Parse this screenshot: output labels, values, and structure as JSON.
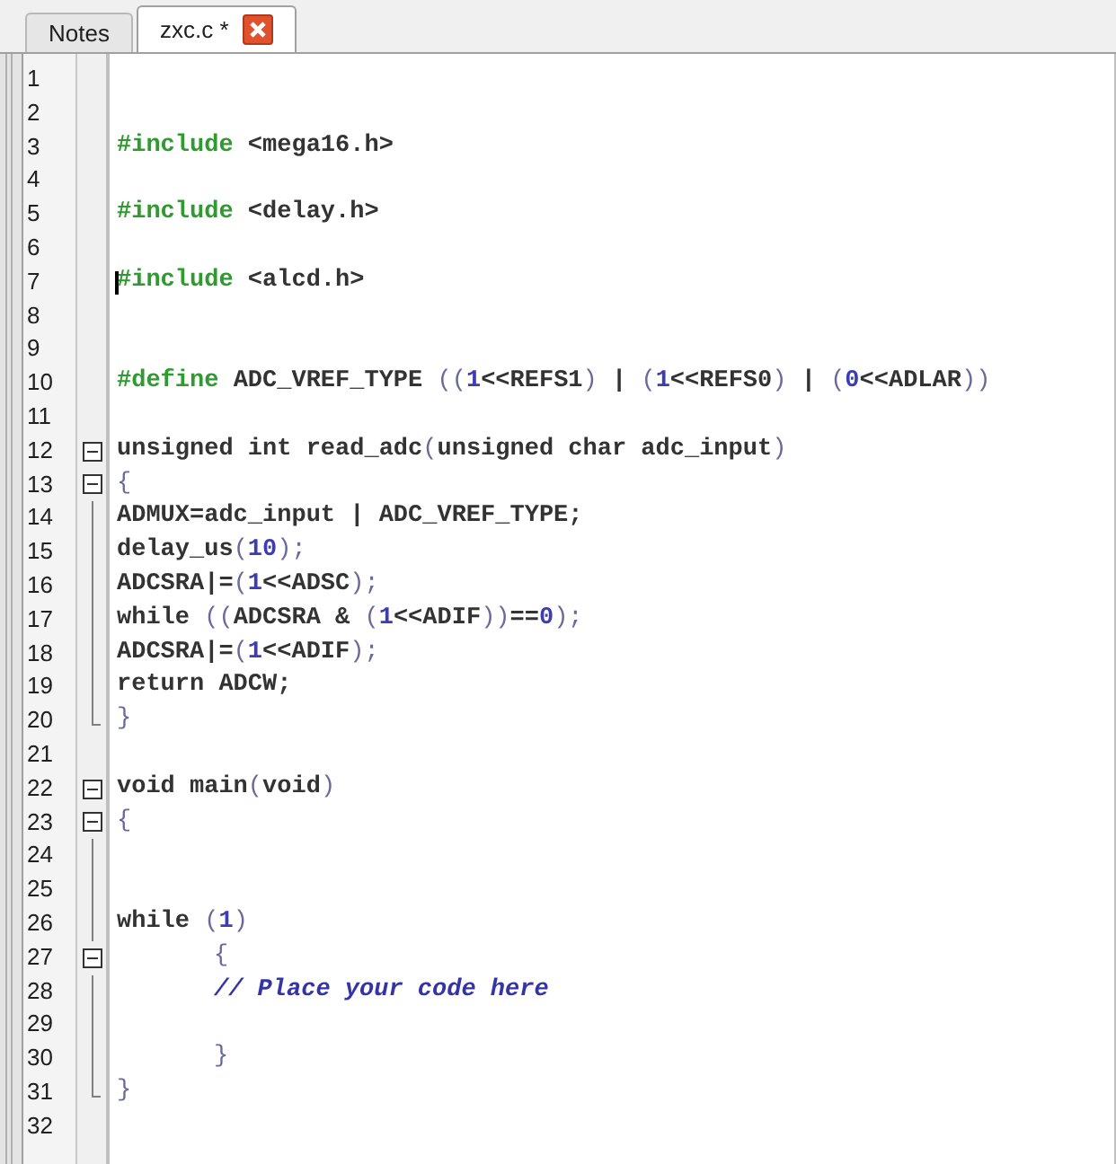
{
  "tabs": [
    {
      "label": "Notes",
      "selected": false,
      "closable": false
    },
    {
      "label": "zxc.c *",
      "selected": true,
      "closable": true
    }
  ],
  "lines": [
    {
      "number": "1",
      "kind": "plain",
      "caret": false
    },
    {
      "number": "2",
      "kind": "plain",
      "caret": false
    },
    {
      "number": "3",
      "kind": "plain",
      "indented": false,
      "caret": false,
      "tokens": [
        {
          "kind": "directive",
          "text": "#include"
        },
        {
          "kind": "plain",
          "text": " <mega16.h>"
        }
      ]
    },
    {
      "number": "4",
      "kind": "plain",
      "caret": false
    },
    {
      "number": "5",
      "kind": "plain",
      "indented": false,
      "caret": false,
      "tokens": [
        {
          "kind": "directive",
          "text": "#include"
        },
        {
          "kind": "plain",
          "text": " <delay.h>"
        }
      ]
    },
    {
      "number": "6",
      "kind": "plain",
      "caret": false
    },
    {
      "number": "7",
      "kind": "plain",
      "indented": false,
      "caret": true,
      "tokens": [
        {
          "kind": "directive",
          "text": "#include"
        },
        {
          "kind": "plain",
          "text": " <alcd.h>"
        }
      ]
    },
    {
      "number": "8",
      "kind": "plain",
      "caret": false
    },
    {
      "number": "9",
      "kind": "plain",
      "caret": false
    },
    {
      "number": "10",
      "kind": "plain",
      "indented": false,
      "caret": false,
      "tokens": [
        {
          "kind": "directive",
          "text": "#define"
        },
        {
          "kind": "plain",
          "text": " ADC_VREF_TYPE "
        },
        {
          "kind": "punct",
          "text": "(("
        },
        {
          "kind": "number",
          "text": "1"
        },
        {
          "kind": "plain",
          "text": "<<REFS1"
        },
        {
          "kind": "punct",
          "text": ")"
        },
        {
          "kind": "plain",
          "text": " | "
        },
        {
          "kind": "punct",
          "text": "("
        },
        {
          "kind": "number",
          "text": "1"
        },
        {
          "kind": "plain",
          "text": "<<REFS0"
        },
        {
          "kind": "punct",
          "text": ")"
        },
        {
          "kind": "plain",
          "text": " | "
        },
        {
          "kind": "punct",
          "text": "("
        },
        {
          "kind": "number",
          "text": "0"
        },
        {
          "kind": "plain",
          "text": "<<ADLAR"
        },
        {
          "kind": "punct",
          "text": "))"
        }
      ]
    },
    {
      "number": "11",
      "kind": "plain",
      "caret": false
    },
    {
      "number": "12",
      "kind": "fold-start",
      "indented": false,
      "caret": false,
      "tokens": [
        {
          "kind": "plain",
          "text": "unsigned int read_adc"
        },
        {
          "kind": "punct",
          "text": "("
        },
        {
          "kind": "plain",
          "text": "unsigned char adc_input"
        },
        {
          "kind": "punct",
          "text": ")"
        }
      ]
    },
    {
      "number": "13",
      "kind": "fold-start",
      "indented": false,
      "caret": false,
      "tokens": [
        {
          "kind": "punct",
          "text": "{"
        }
      ]
    },
    {
      "number": "14",
      "kind": "fold-inner",
      "indented": false,
      "caret": false,
      "tokens": [
        {
          "kind": "plain",
          "text": "ADMUX=adc_input | ADC_VREF_TYPE;"
        }
      ]
    },
    {
      "number": "15",
      "kind": "fold-inner",
      "indented": false,
      "caret": false,
      "tokens": [
        {
          "kind": "plain",
          "text": "delay_us"
        },
        {
          "kind": "punct",
          "text": "("
        },
        {
          "kind": "number",
          "text": "10"
        },
        {
          "kind": "punct",
          "text": ");"
        }
      ]
    },
    {
      "number": "16",
      "kind": "fold-inner",
      "indented": false,
      "caret": false,
      "tokens": [
        {
          "kind": "plain",
          "text": "ADCSRA|="
        },
        {
          "kind": "punct",
          "text": "("
        },
        {
          "kind": "number",
          "text": "1"
        },
        {
          "kind": "plain",
          "text": "<<ADSC"
        },
        {
          "kind": "punct",
          "text": ");"
        }
      ]
    },
    {
      "number": "17",
      "kind": "fold-inner",
      "indented": false,
      "caret": false,
      "tokens": [
        {
          "kind": "plain",
          "text": "while "
        },
        {
          "kind": "punct",
          "text": "(("
        },
        {
          "kind": "plain",
          "text": "ADCSRA & "
        },
        {
          "kind": "punct",
          "text": "("
        },
        {
          "kind": "number",
          "text": "1"
        },
        {
          "kind": "plain",
          "text": "<<ADIF"
        },
        {
          "kind": "punct",
          "text": "))"
        },
        {
          "kind": "plain",
          "text": "=="
        },
        {
          "kind": "number",
          "text": "0"
        },
        {
          "kind": "punct",
          "text": ");"
        }
      ]
    },
    {
      "number": "18",
      "kind": "fold-inner",
      "indented": false,
      "caret": false,
      "tokens": [
        {
          "kind": "plain",
          "text": "ADCSRA|="
        },
        {
          "kind": "punct",
          "text": "("
        },
        {
          "kind": "number",
          "text": "1"
        },
        {
          "kind": "plain",
          "text": "<<ADIF"
        },
        {
          "kind": "punct",
          "text": ");"
        }
      ]
    },
    {
      "number": "19",
      "kind": "fold-inner",
      "indented": false,
      "caret": false,
      "tokens": [
        {
          "kind": "plain",
          "text": "return ADCW;"
        }
      ]
    },
    {
      "number": "20",
      "kind": "fold-end",
      "indented": false,
      "caret": false,
      "tokens": [
        {
          "kind": "punct",
          "text": "}"
        }
      ]
    },
    {
      "number": "21",
      "kind": "plain",
      "caret": false
    },
    {
      "number": "22",
      "kind": "fold-start",
      "indented": false,
      "caret": false,
      "tokens": [
        {
          "kind": "plain",
          "text": "void main"
        },
        {
          "kind": "punct",
          "text": "("
        },
        {
          "kind": "plain",
          "text": "void"
        },
        {
          "kind": "punct",
          "text": ")"
        }
      ]
    },
    {
      "number": "23",
      "kind": "fold-start",
      "indented": false,
      "caret": false,
      "tokens": [
        {
          "kind": "punct",
          "text": "{"
        }
      ]
    },
    {
      "number": "24",
      "kind": "fold-inner",
      "caret": false
    },
    {
      "number": "25",
      "kind": "fold-inner",
      "caret": false
    },
    {
      "number": "26",
      "kind": "fold-inner",
      "indented": false,
      "caret": false,
      "tokens": [
        {
          "kind": "plain",
          "text": "while "
        },
        {
          "kind": "punct",
          "text": "("
        },
        {
          "kind": "number",
          "text": "1"
        },
        {
          "kind": "punct",
          "text": ")"
        }
      ]
    },
    {
      "number": "27",
      "kind": "fold-start",
      "indented": true,
      "caret": false,
      "tokens": [
        {
          "kind": "punct",
          "text": "{"
        }
      ]
    },
    {
      "number": "28",
      "kind": "fold-inner",
      "indented": true,
      "caret": false,
      "tokens": [
        {
          "kind": "comment",
          "text": "// Place your code here"
        }
      ]
    },
    {
      "number": "29",
      "kind": "fold-inner",
      "caret": false
    },
    {
      "number": "30",
      "kind": "fold-inner",
      "indented": true,
      "caret": false,
      "tokens": [
        {
          "kind": "punct",
          "text": "}"
        }
      ]
    },
    {
      "number": "31",
      "kind": "fold-end",
      "indented": false,
      "caret": false,
      "tokens": [
        {
          "kind": "punct",
          "text": "}"
        }
      ]
    },
    {
      "number": "32",
      "kind": "plain",
      "caret": false
    }
  ]
}
